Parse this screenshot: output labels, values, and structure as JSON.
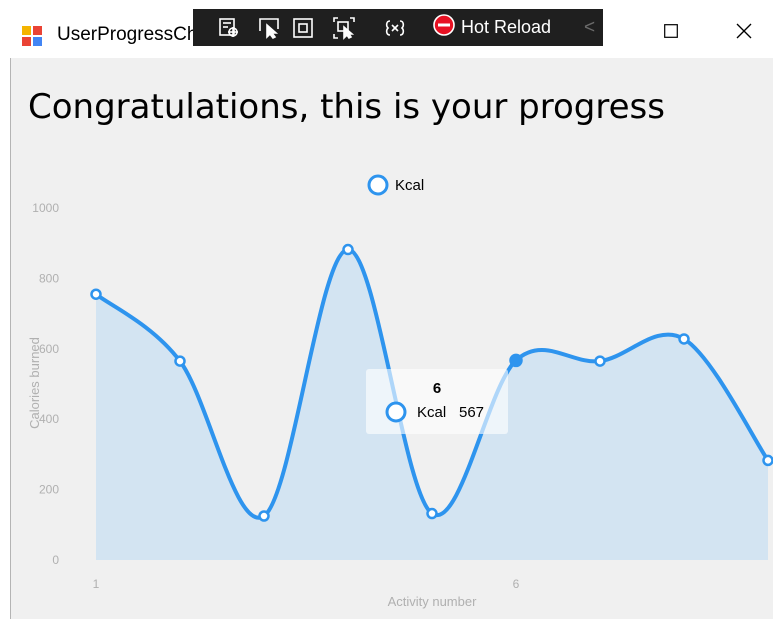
{
  "window": {
    "title": "UserProgressCha",
    "hot_reload_label": "Hot Reload",
    "devbar_chevron": "<"
  },
  "page": {
    "heading": "Congratulations, this is your progress"
  },
  "colors": {
    "series": "#2e94ee",
    "area": "#d3e4f2",
    "axis_text": "#b0b0b0",
    "background": "#f0f0f0",
    "devbar": "#1f1f1f",
    "hot_reload": "#e81123"
  },
  "chart_data": {
    "type": "area",
    "legend": {
      "position": "top-center",
      "entries": [
        "Kcal"
      ]
    },
    "xlabel": "Activity number",
    "ylabel": "Calories burned",
    "x_tick_labels": [
      "1",
      "6"
    ],
    "y_ticks": [
      0,
      200,
      400,
      600,
      800,
      1000
    ],
    "ylim": [
      0,
      1000
    ],
    "grid": false,
    "series": [
      {
        "name": "Kcal",
        "x": [
          1,
          2,
          3,
          4,
          5,
          6,
          7,
          8,
          9
        ],
        "values": [
          755,
          565,
          125,
          882,
          132,
          567,
          565,
          628,
          283
        ]
      }
    ],
    "tooltip": {
      "title": "6",
      "series": "Kcal",
      "value": "567"
    },
    "highlighted_point": 6
  }
}
